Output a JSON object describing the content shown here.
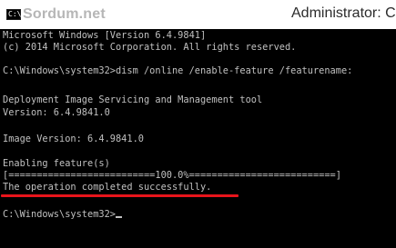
{
  "titlebar": {
    "icon_glyph": "C:\\_",
    "watermark": "Sordum.net",
    "title": "Administrator: Co"
  },
  "console": {
    "lines": [
      "Microsoft Windows [Version 6.4.9841]",
      "(c) 2014 Microsoft Corporation. All rights reserved.",
      "",
      "C:\\Windows\\system32>dism /online /enable-feature /featurename:",
      "",
      "Deployment Image Servicing and Management tool",
      "Version: 6.4.9841.0",
      "",
      "Image Version: 6.4.9841.0",
      "",
      "Enabling feature(s)",
      "[==========================100.0%==========================]",
      "The operation completed successfully.",
      "",
      "C:\\Windows\\system32>"
    ]
  },
  "colors": {
    "console_bg": "#000000",
    "console_text": "#c0c0c0",
    "highlight_underline": "#e8141b",
    "watermark": "#b6b6b6"
  }
}
